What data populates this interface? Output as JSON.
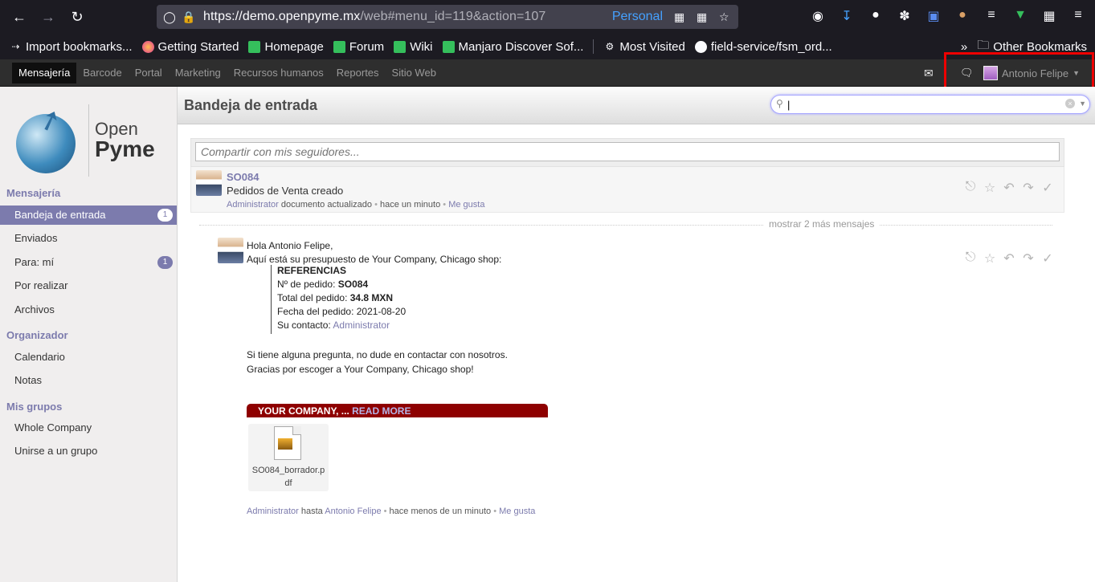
{
  "browser": {
    "url_host": "https://demo.openpyme.mx",
    "url_path": "/web#menu_id=119&action=107",
    "container": "Personal",
    "bookmarks": [
      {
        "label": "Import bookmarks..."
      },
      {
        "label": "Getting Started"
      },
      {
        "label": "Homepage"
      },
      {
        "label": "Forum"
      },
      {
        "label": "Wiki"
      },
      {
        "label": "Manjaro Discover Sof..."
      },
      {
        "label": "Most Visited"
      },
      {
        "label": "field-service/fsm_ord..."
      }
    ],
    "other_bookmarks": "Other Bookmarks"
  },
  "topnav": {
    "items": [
      "Mensajería",
      "Barcode",
      "Portal",
      "Marketing",
      "Recursos humanos",
      "Reportes",
      "Sitio Web"
    ],
    "user_name": "Antonio Felipe"
  },
  "logo": {
    "line1": "Open",
    "line2": "Pyme"
  },
  "sidebar": {
    "sections": [
      {
        "title": "Mensajería"
      },
      {
        "title": "Organizador"
      },
      {
        "title": "Mis grupos"
      }
    ],
    "items": [
      {
        "label": "Bandeja de entrada",
        "badge": "1"
      },
      {
        "label": "Enviados"
      },
      {
        "label": "Para: mí",
        "badge": "1"
      },
      {
        "label": "Por realizar"
      },
      {
        "label": "Archivos"
      },
      {
        "label": "Calendario"
      },
      {
        "label": "Notas"
      },
      {
        "label": "Whole Company"
      },
      {
        "label": "Unirse a un grupo"
      }
    ]
  },
  "header": {
    "title": "Bandeja de entrada",
    "search_value": "|"
  },
  "compose": {
    "placeholder": "Compartir con mis seguidores..."
  },
  "message1": {
    "title": "SO084",
    "body": "Pedidos de Venta creado",
    "author": "Administrator",
    "action": "documento actualizado",
    "time": "hace un minuto",
    "like": "Me gusta"
  },
  "more_messages": "mostrar 2 más mensajes",
  "message2": {
    "greeting": "Hola Antonio Felipe,",
    "intro": "Aquí está su presupuesto de Your Company, Chicago shop:",
    "ref_title": "REFERENCIAS",
    "order_label": "Nº de pedido: ",
    "order_value": "SO084",
    "total_label": "Total del pedido: ",
    "total_value": "34.8 MXN",
    "date_label": "Fecha del pedido: ",
    "date_value": "2021-08-20",
    "contact_label": "Su contacto: ",
    "contact_value": "Administrator",
    "question": "Si tiene alguna pregunta, no dude en contactar con nosotros.",
    "thanks": "Gracias por escoger a Your Company, Chicago shop!",
    "company_bar": "YOUR COMPANY, ... ",
    "read_more": "READ MORE",
    "attachment": "SO084_borrador.pdf",
    "author": "Administrator",
    "to_label": "hasta",
    "recipient": "Antonio Felipe",
    "time": "hace menos de un minuto",
    "like": "Me gusta"
  }
}
